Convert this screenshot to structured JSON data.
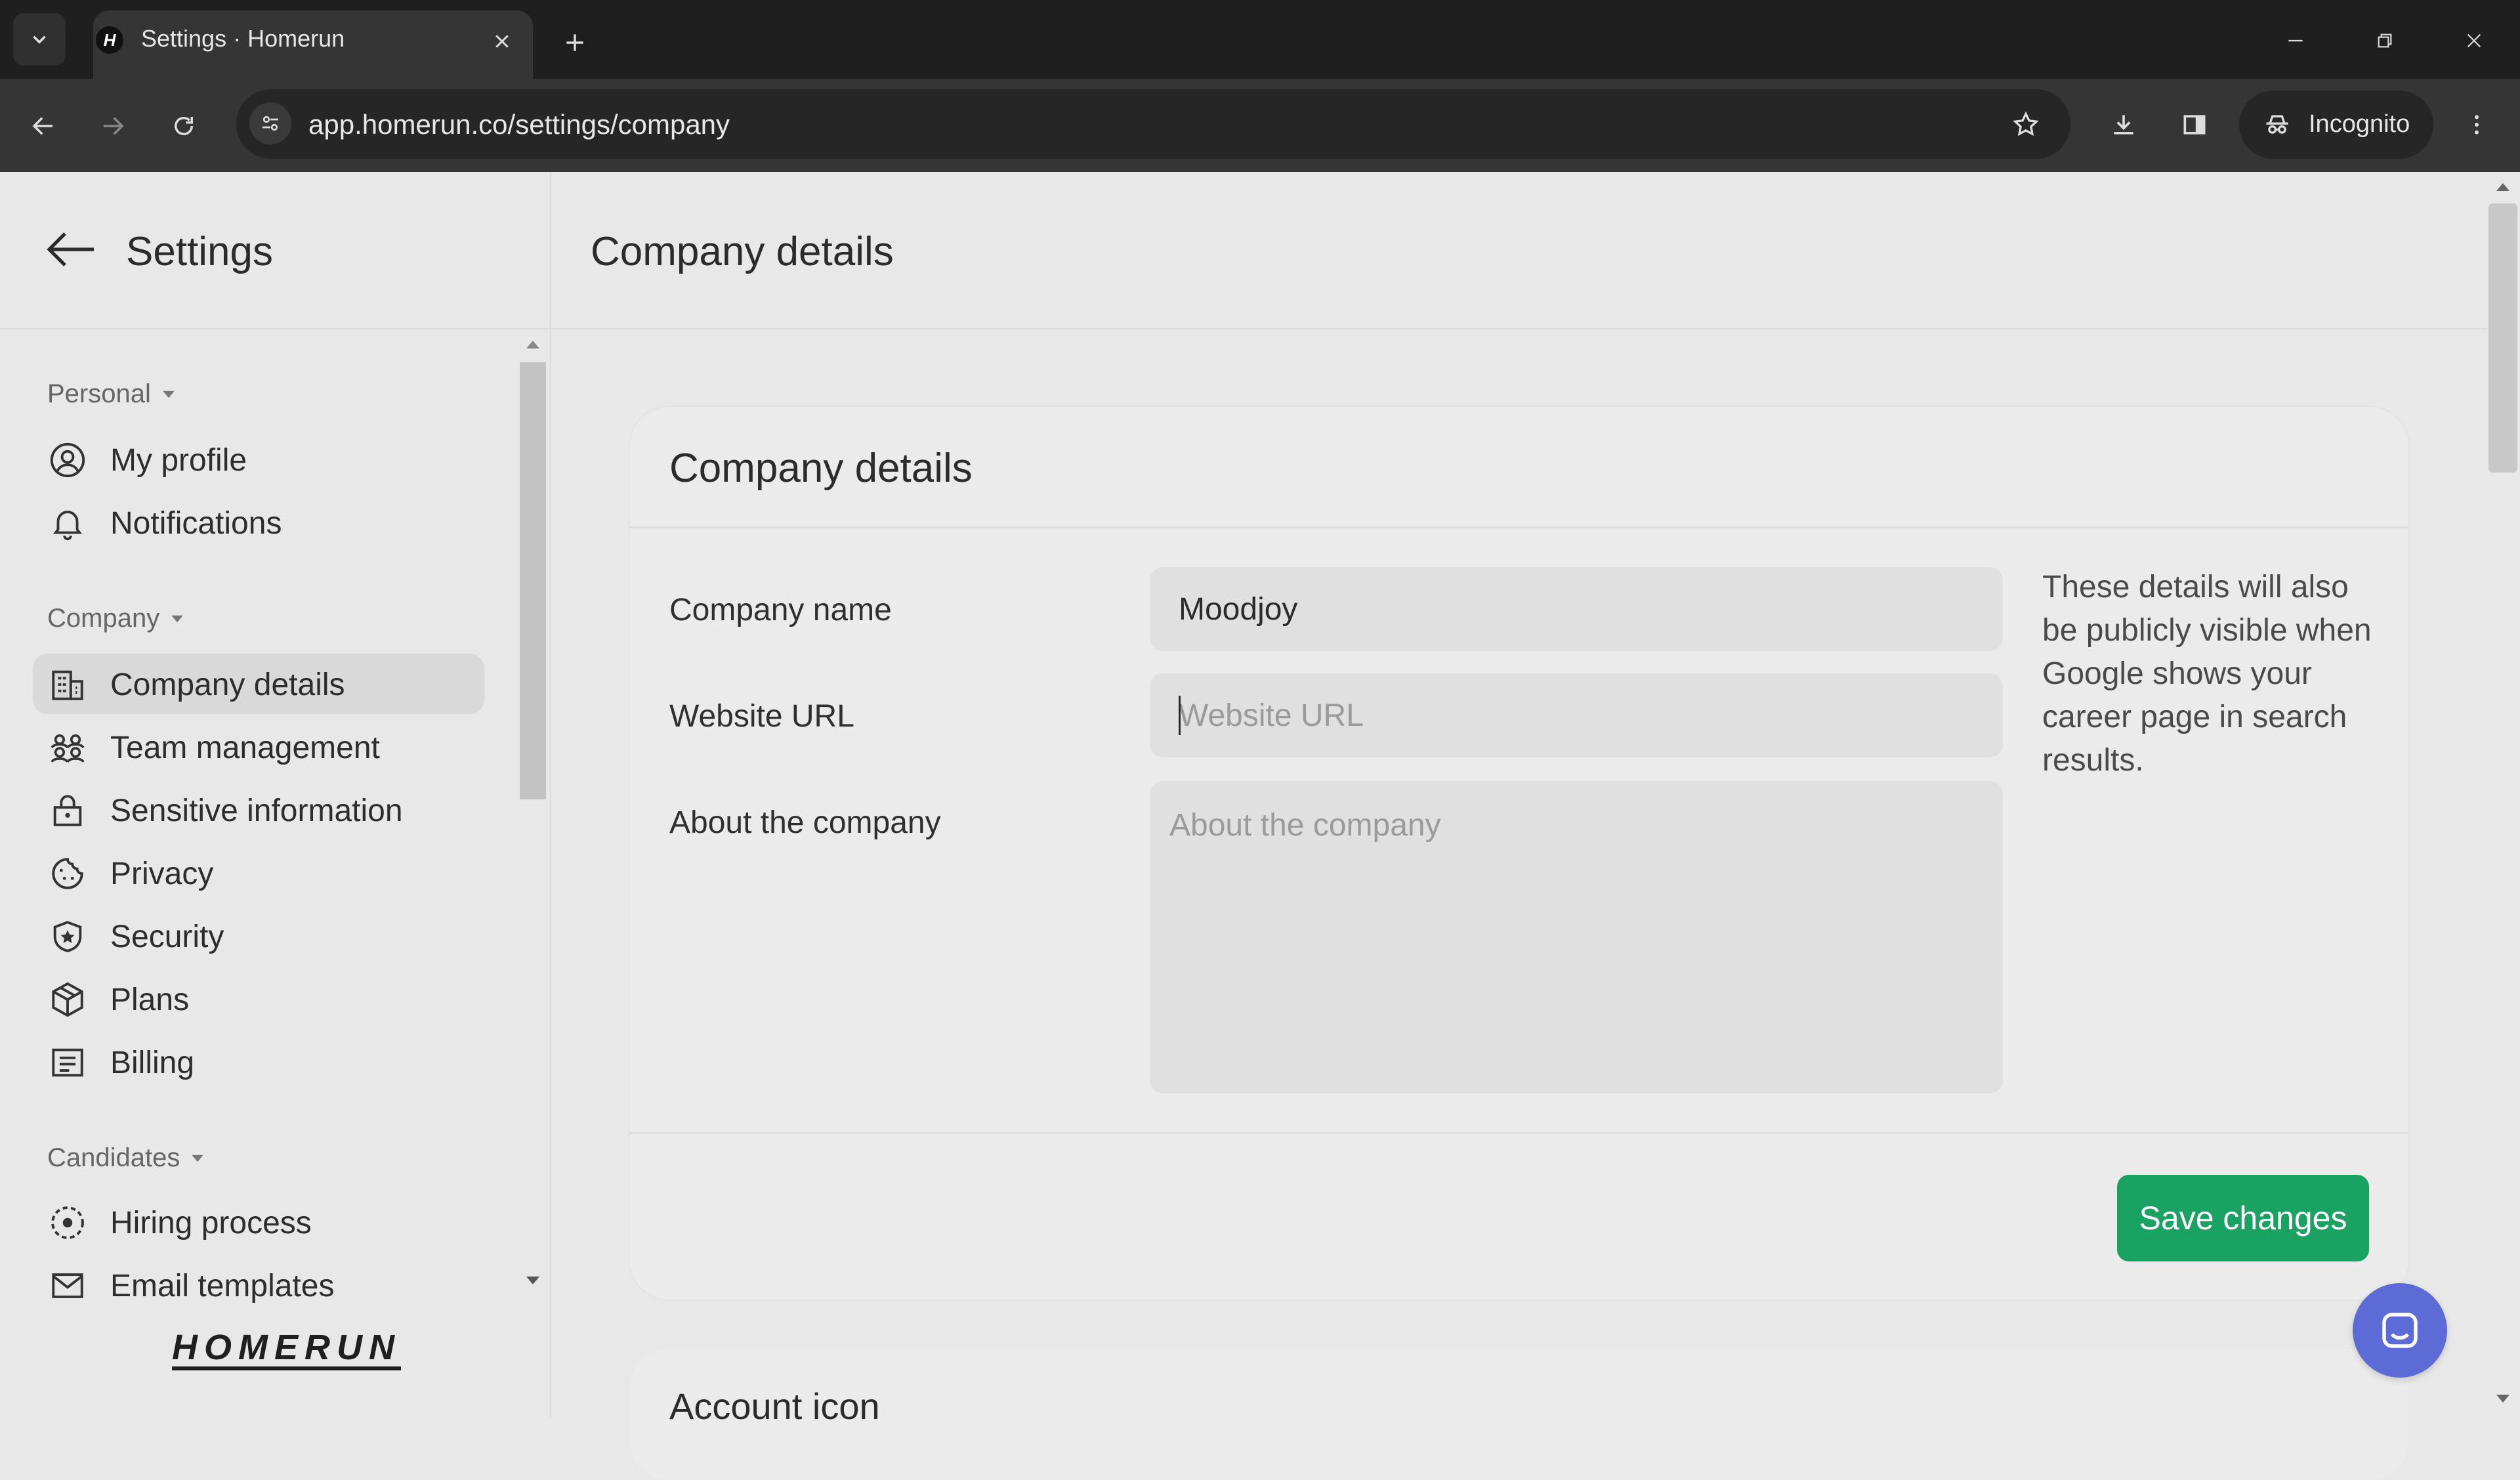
{
  "browser": {
    "tab_title": "Settings · Homerun",
    "url": "app.homerun.co/settings/company",
    "incognito_label": "Incognito"
  },
  "sidebar": {
    "title": "Settings",
    "sections": [
      {
        "label": "Personal",
        "items": [
          {
            "label": "My profile",
            "icon": "user-circle-icon"
          },
          {
            "label": "Notifications",
            "icon": "bell-icon"
          }
        ]
      },
      {
        "label": "Company",
        "items": [
          {
            "label": "Company details",
            "icon": "building-icon",
            "active": true
          },
          {
            "label": "Team management",
            "icon": "team-icon"
          },
          {
            "label": "Sensitive information",
            "icon": "lock-icon"
          },
          {
            "label": "Privacy",
            "icon": "cookie-icon"
          },
          {
            "label": "Security",
            "icon": "shield-star-icon"
          },
          {
            "label": "Plans",
            "icon": "package-icon"
          },
          {
            "label": "Billing",
            "icon": "receipt-icon"
          }
        ]
      },
      {
        "label": "Candidates",
        "items": [
          {
            "label": "Hiring process",
            "icon": "process-icon"
          },
          {
            "label": "Email templates",
            "icon": "mail-icon"
          }
        ]
      }
    ],
    "logo_text": "HOMERUN"
  },
  "main": {
    "page_title": "Company details",
    "card": {
      "title": "Company details",
      "fields": {
        "company_name": {
          "label": "Company name",
          "value": "Moodjoy"
        },
        "website_url": {
          "label": "Website URL",
          "value": "",
          "placeholder": "Website URL"
        },
        "about": {
          "label": "About the company",
          "value": "",
          "placeholder": "About the company"
        }
      },
      "help_text": "These details will also be publicly visible when Google shows your career page in search results.",
      "save_label": "Save changes"
    },
    "next_card_title": "Account icon"
  },
  "colors": {
    "accent_green": "#1aa262",
    "chat_blue": "#5c6bd6"
  }
}
